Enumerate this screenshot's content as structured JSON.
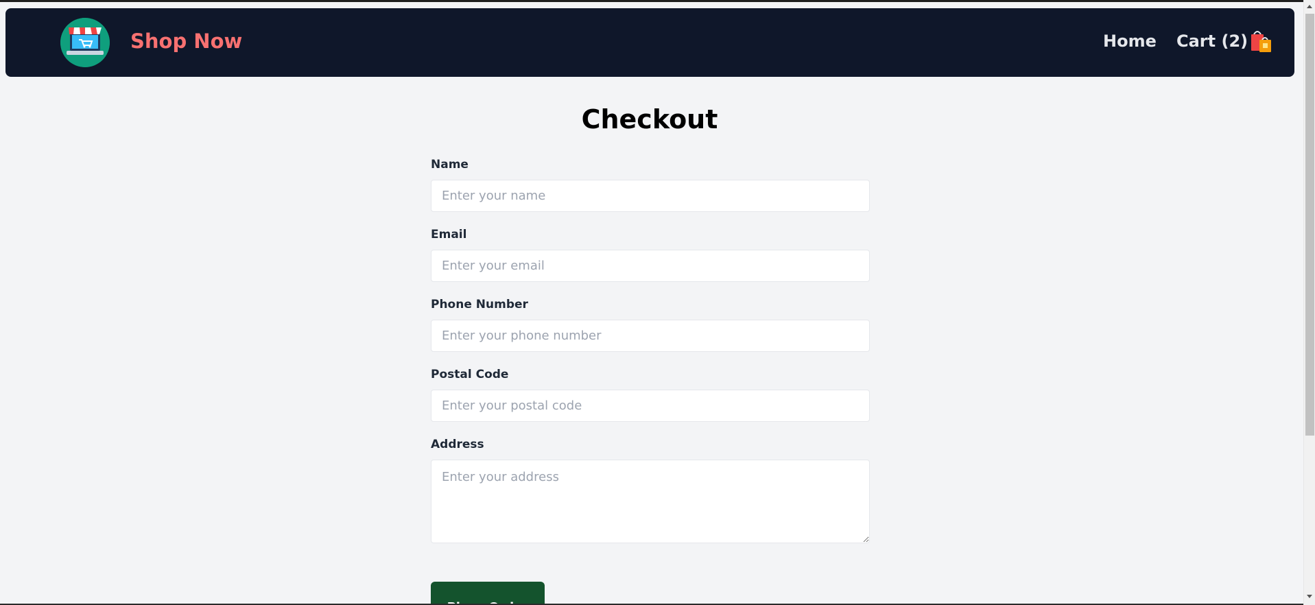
{
  "header": {
    "brand": "Shop Now",
    "logo_icon": "shop-store-laptop-icon",
    "nav": {
      "home": "Home",
      "cart": "Cart (2)",
      "cart_icon": "shopping-bags-icon"
    }
  },
  "page": {
    "title": "Checkout"
  },
  "form": {
    "name": {
      "label": "Name",
      "placeholder": "Enter your name",
      "value": ""
    },
    "email": {
      "label": "Email",
      "placeholder": "Enter your email",
      "value": ""
    },
    "phone": {
      "label": "Phone Number",
      "placeholder": "Enter your phone number",
      "value": ""
    },
    "postal": {
      "label": "Postal Code",
      "placeholder": "Enter your postal code",
      "value": ""
    },
    "address": {
      "label": "Address",
      "placeholder": "Enter your address",
      "value": ""
    },
    "submit_label": "Place Order"
  },
  "colors": {
    "navbar": "#0f172a",
    "brand": "#f87171",
    "button": "#14532d",
    "background": "#f3f4f6"
  }
}
